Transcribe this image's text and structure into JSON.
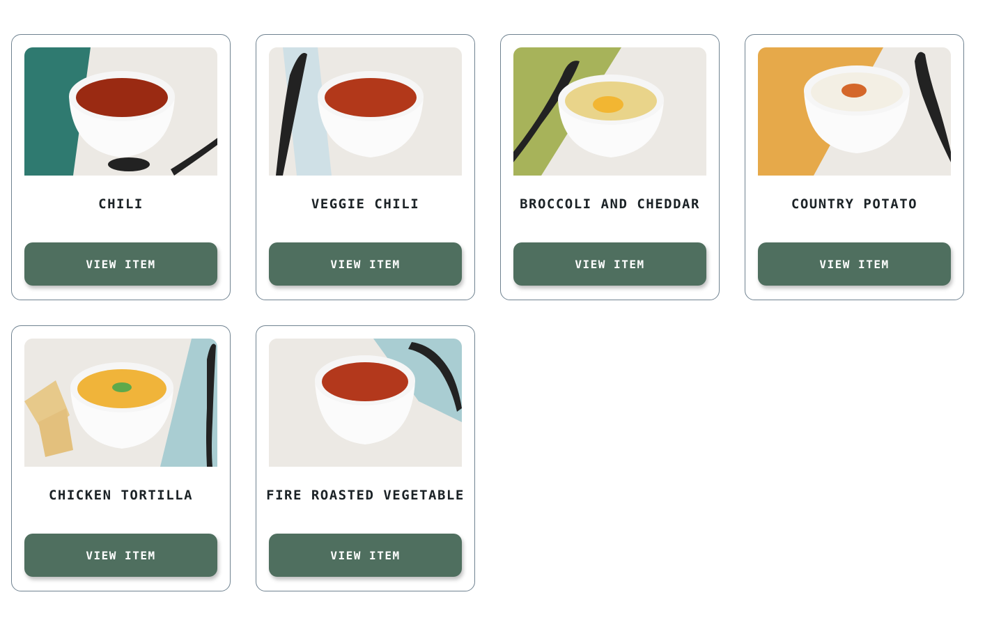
{
  "products": [
    {
      "name": "CHILI",
      "button_label": "VIEW ITEM",
      "image": "bowl-of-chili",
      "soup_color": "#9a2a12",
      "cloth_color": "#2f7a70"
    },
    {
      "name": "VEGGIE CHILI",
      "button_label": "VIEW ITEM",
      "image": "bowl-of-veggie-chili",
      "soup_color": "#b2381a",
      "cloth_color": "#cfe0e6"
    },
    {
      "name": "BROCCOLI AND CHEDDAR",
      "button_label": "VIEW ITEM",
      "image": "bowl-of-broccoli-cheddar-soup",
      "soup_color": "#e9d48a",
      "cloth_color": "#a7b35a"
    },
    {
      "name": "COUNTRY POTATO",
      "button_label": "VIEW ITEM",
      "image": "bowl-of-country-potato-soup",
      "soup_color": "#f3efe4",
      "cloth_color": "#e6a94a"
    },
    {
      "name": "CHICKEN TORTILLA",
      "button_label": "VIEW ITEM",
      "image": "bowl-of-chicken-tortilla-soup",
      "soup_color": "#f0b43a",
      "cloth_color": "#a9cdd2"
    },
    {
      "name": "FIRE ROASTED VEGETABLE",
      "button_label": "VIEW ITEM",
      "image": "bowl-of-fire-roasted-vegetable-soup",
      "soup_color": "#b3381c",
      "cloth_color": "#a9cdd2"
    }
  ],
  "colors": {
    "button": "#4f6f5f",
    "card_border": "#6f8290",
    "text": "#1b2226"
  }
}
